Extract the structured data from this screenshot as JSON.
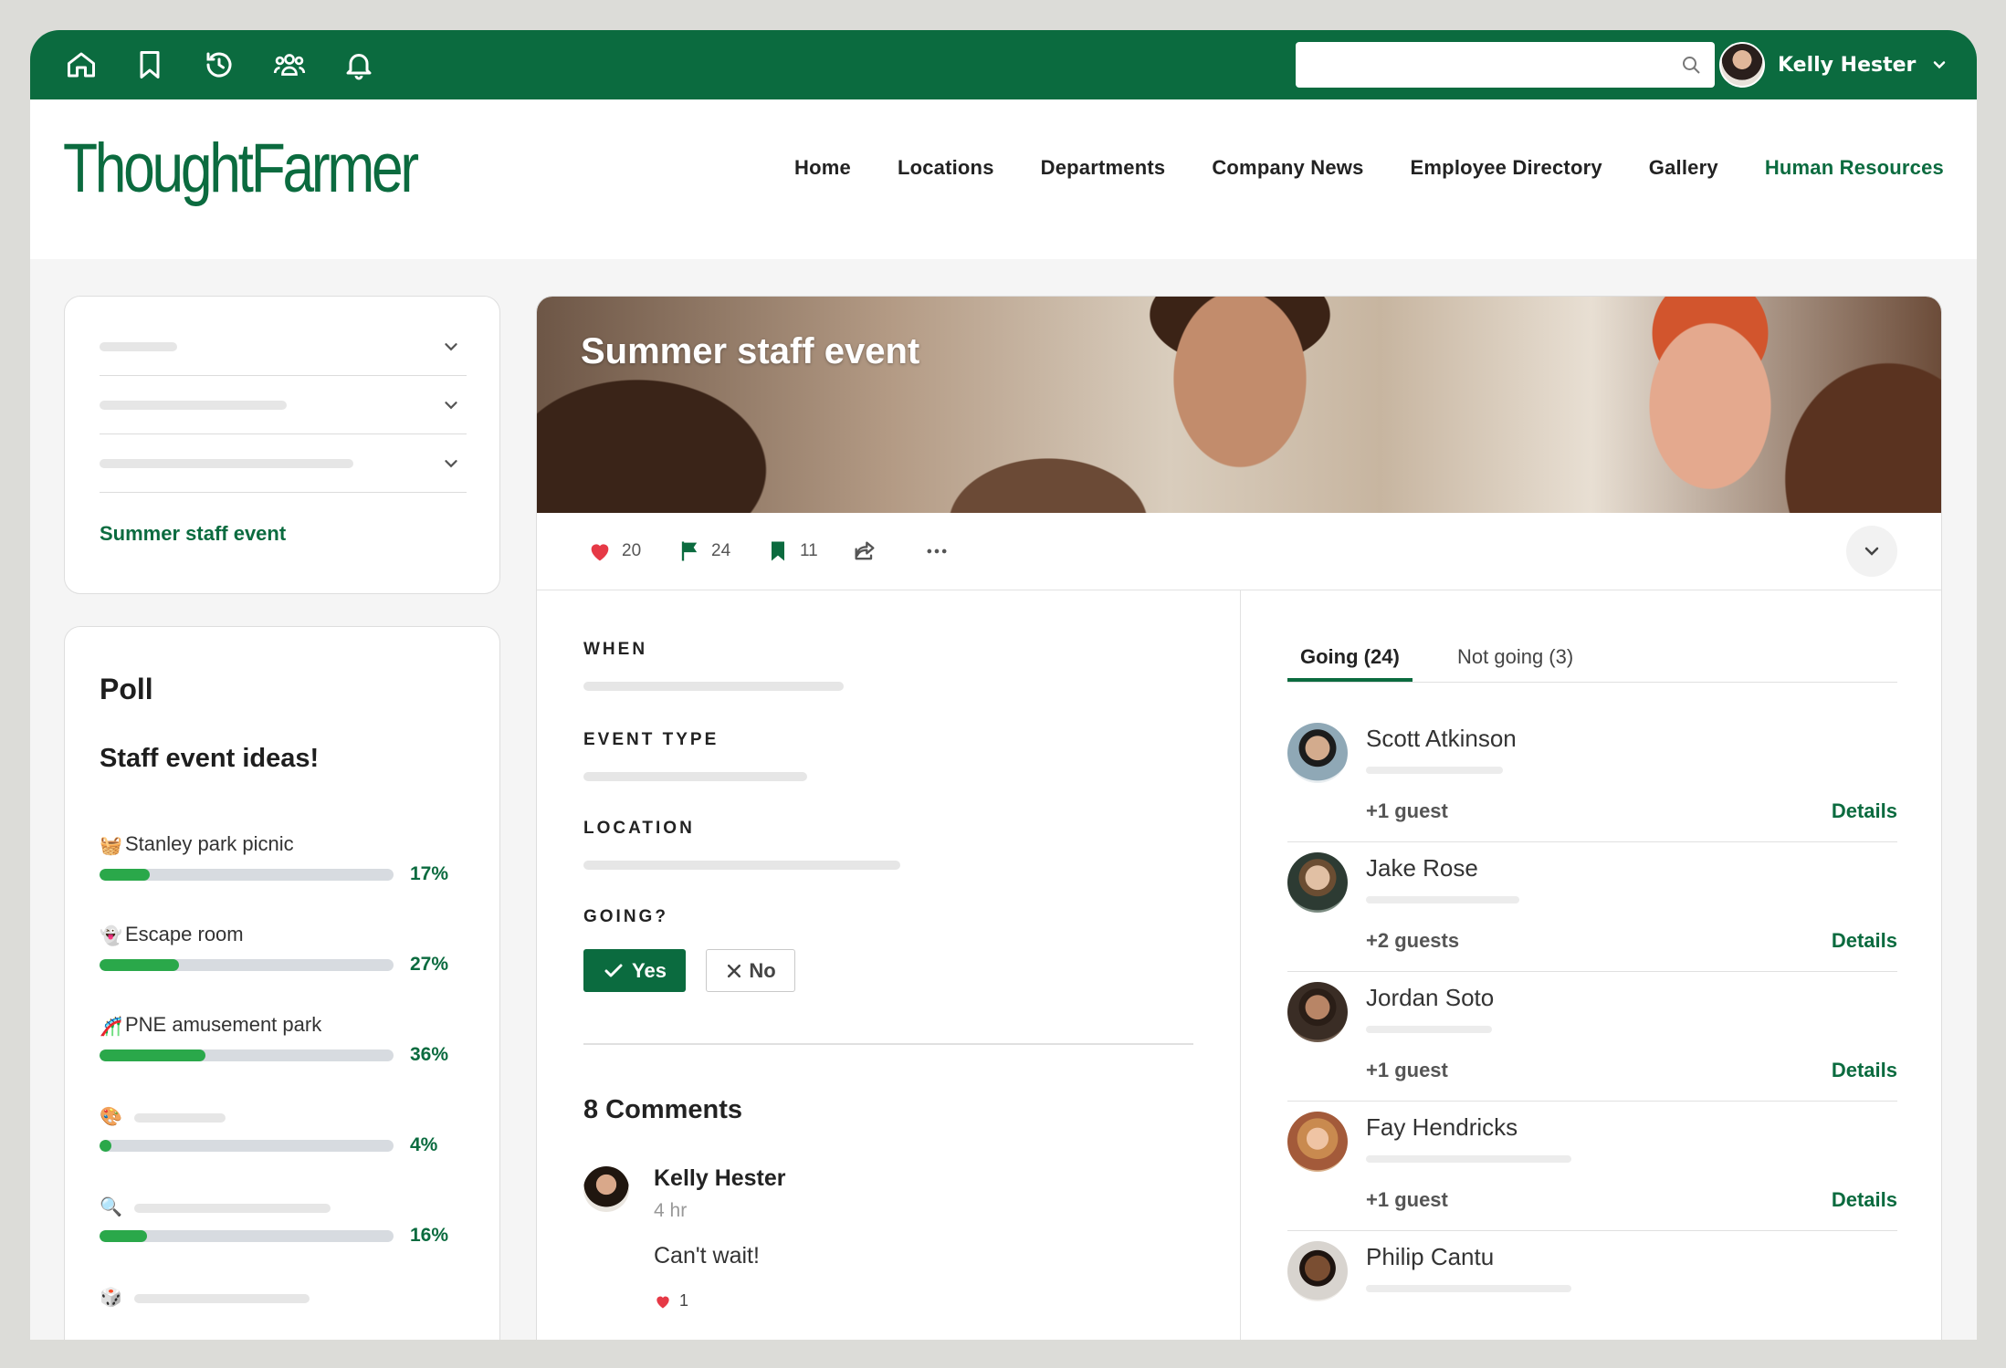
{
  "colors": {
    "brand": "#0b6b3f",
    "bar_fill": "#2aa84a",
    "bar_track": "#d7dbe0",
    "heart": "#e63946"
  },
  "topbar": {
    "icons": [
      "home-icon",
      "bookmark-icon",
      "history-icon",
      "people-icon",
      "bell-icon"
    ],
    "search": {
      "placeholder": "",
      "value": ""
    },
    "user": {
      "name": "Kelly Hester"
    }
  },
  "header": {
    "logo": "ThoughtFarmer",
    "nav": [
      "Home",
      "Locations",
      "Departments",
      "Company News",
      "Employee Directory",
      "Gallery",
      "Human Resources"
    ],
    "active_nav": "Human Resources"
  },
  "sidebar": {
    "current_item": "Summer staff event"
  },
  "poll": {
    "title": "Poll",
    "question": "Staff event ideas!",
    "options": [
      {
        "emoji": "🧺",
        "label": "Stanley park picnic",
        "percent": 17,
        "percent_label": "17%"
      },
      {
        "emoji": "👻",
        "label": "Escape room",
        "percent": 27,
        "percent_label": "27%"
      },
      {
        "emoji": "🎢",
        "label": "PNE amusement park",
        "percent": 36,
        "percent_label": "36%"
      },
      {
        "emoji": "🎨",
        "label": "",
        "percent": 4,
        "percent_label": "4%"
      },
      {
        "emoji": "🔍",
        "label": "",
        "percent": 16,
        "percent_label": "16%"
      },
      {
        "emoji": "🎲",
        "label": ""
      }
    ]
  },
  "event": {
    "title": "Summer staff event",
    "actions": {
      "likes": "20",
      "flags": "24",
      "bookmarks": "11"
    },
    "labels": {
      "when": "WHEN",
      "event_type": "EVENT TYPE",
      "location": "LOCATION",
      "going": "GOING?"
    },
    "rsvp": {
      "yes": "Yes",
      "no": "No",
      "selected": "Yes"
    },
    "comments": {
      "title": "8 Comments",
      "items": [
        {
          "author": "Kelly Hester",
          "time": "4 hr",
          "text": "Can't wait!",
          "likes": "1"
        }
      ]
    },
    "attendance": {
      "tabs": [
        "Going (24)",
        "Not going (3)"
      ],
      "active_tab": "Going (24)",
      "details_label": "Details",
      "guests": [
        {
          "name": "Scott Atkinson",
          "guests": "+1 guest"
        },
        {
          "name": "Jake Rose",
          "guests": "+2 guests"
        },
        {
          "name": "Jordan Soto",
          "guests": "+1 guest"
        },
        {
          "name": "Fay Hendricks",
          "guests": "+1 guest"
        },
        {
          "name": "Philip Cantu",
          "guests": ""
        }
      ]
    }
  }
}
